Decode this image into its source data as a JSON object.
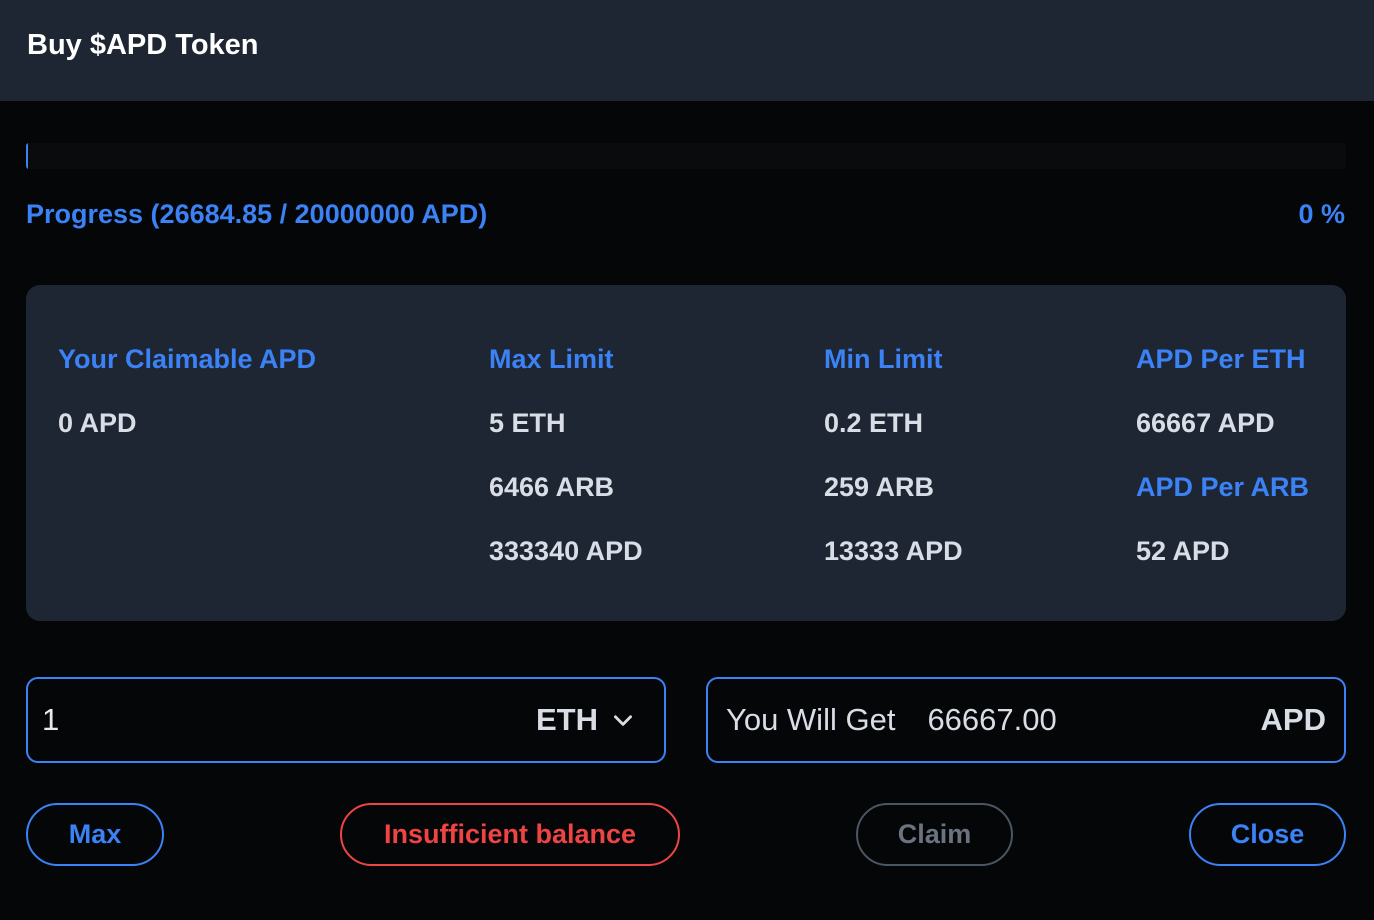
{
  "header": {
    "title": "Buy $APD Token"
  },
  "progress": {
    "label": "Progress (26684.85 / 20000000 APD)",
    "percent_text": "0 %",
    "fraction": 0.0013
  },
  "info": {
    "claimable": {
      "label": "Your Claimable APD",
      "value": "0 APD"
    },
    "max_limit": {
      "label": "Max Limit",
      "values": [
        "5 ETH",
        "6466 ARB",
        "333340 APD"
      ]
    },
    "min_limit": {
      "label": "Min Limit",
      "values": [
        "0.2 ETH",
        "259 ARB",
        "13333 APD"
      ]
    },
    "rates": {
      "eth_label": "APD Per ETH",
      "eth_value": "66667 APD",
      "arb_label": "APD Per ARB",
      "arb_value": "52 APD"
    }
  },
  "form": {
    "amount_value": "1",
    "currency": "ETH",
    "you_will_get_label": "You Will Get",
    "you_will_get_value": "66667.00",
    "you_will_get_unit": "APD"
  },
  "buttons": {
    "max": "Max",
    "insufficient": "Insufficient balance",
    "claim": "Claim",
    "close": "Close"
  },
  "colors": {
    "accent": "#3b82f6",
    "danger": "#ef4444",
    "disabled": "#6b7280",
    "panel": "#1f2633",
    "background": "#050607"
  },
  "icons": {
    "currency_dropdown": "chevron-down-icon"
  }
}
